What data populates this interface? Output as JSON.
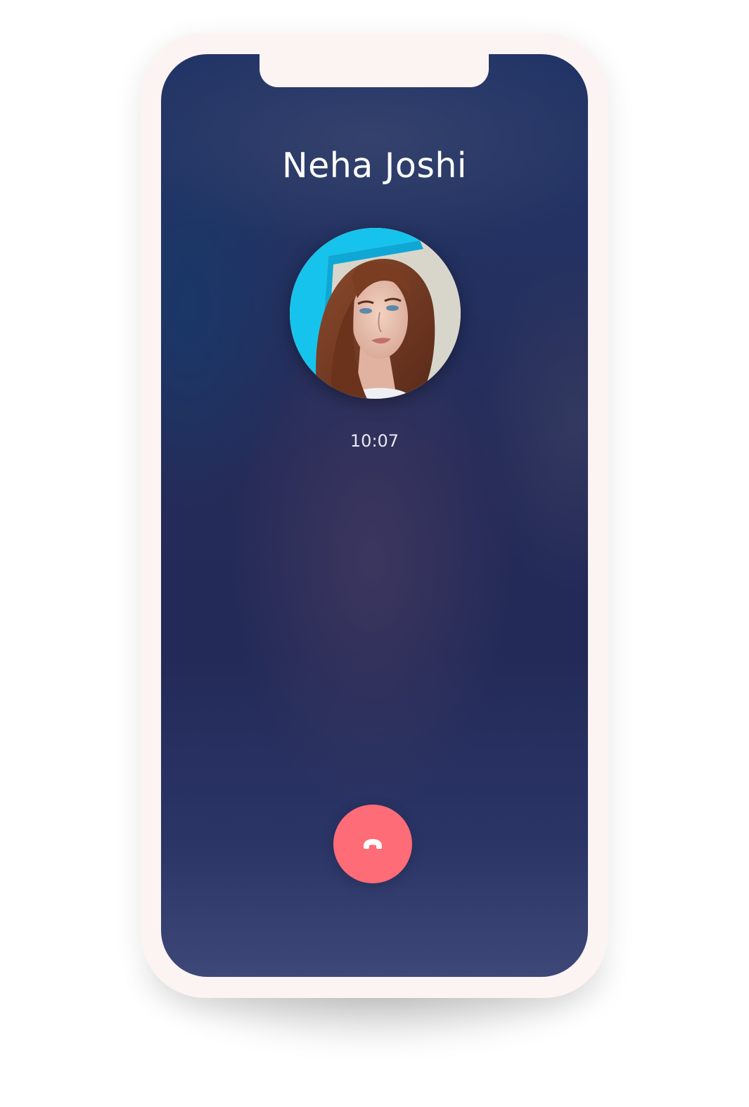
{
  "call": {
    "caller_name": "Neha Joshi",
    "duration": "10:07",
    "avatar_icon": "caller-photo",
    "end_call_icon": "phone-hangup-icon"
  },
  "colors": {
    "device_frame": "#fcf3f3",
    "screen_top": "#213466",
    "screen_bottom": "#3d4778",
    "end_call_button": "#fe6c77",
    "text": "#ffffff"
  }
}
